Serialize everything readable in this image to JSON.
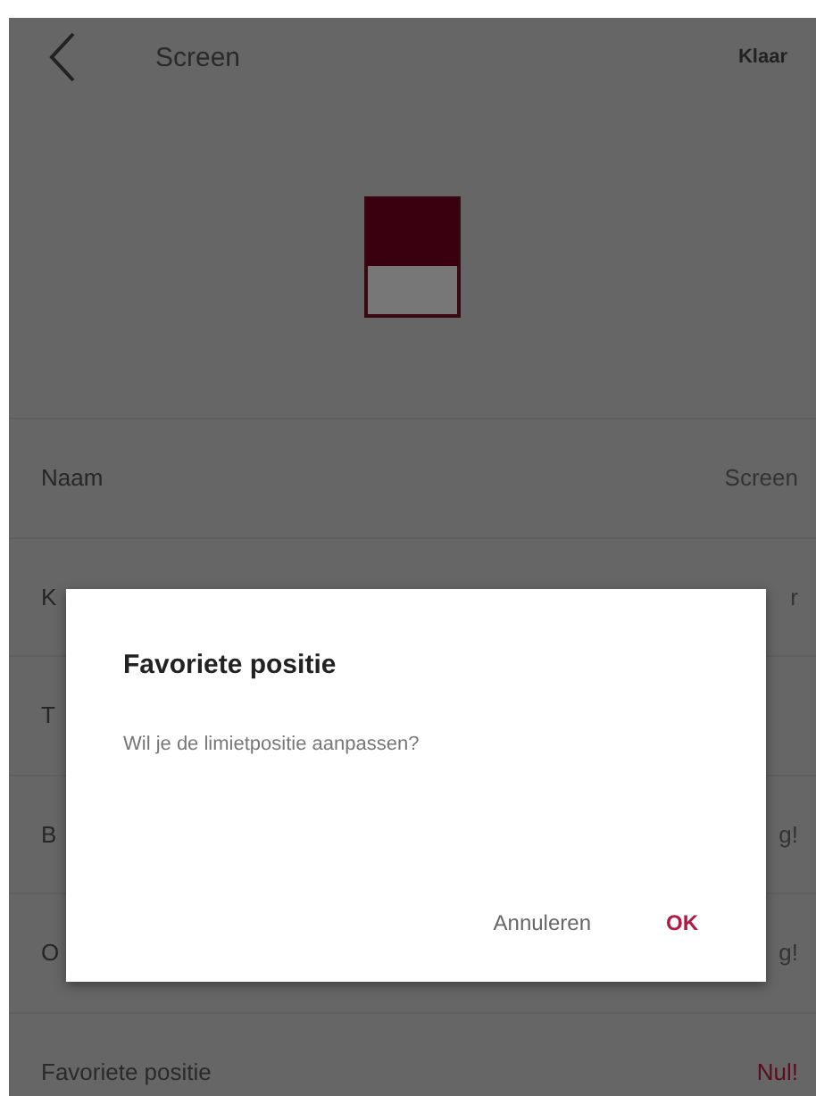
{
  "header": {
    "title": "Screen",
    "action": "Klaar"
  },
  "rows": [
    {
      "label": "Naam",
      "value": "Screen",
      "kind": "plain"
    },
    {
      "label": "K",
      "value": "r",
      "kind": "plain"
    },
    {
      "label": "T",
      "kind": "plain"
    },
    {
      "label": "B",
      "value": "g!",
      "kind": "plain"
    },
    {
      "label": "O",
      "value": "g!",
      "kind": "plain"
    },
    {
      "label": "Favoriete positie",
      "value": "Nul!",
      "kind": "accent"
    }
  ],
  "dialog": {
    "title": "Favoriete positie",
    "message": "Wil je de limietpositie aanpassen?",
    "buttons": [
      {
        "label": "Annuleren",
        "kind": "cancel"
      },
      {
        "label": "OK",
        "kind": "confirm"
      }
    ]
  }
}
